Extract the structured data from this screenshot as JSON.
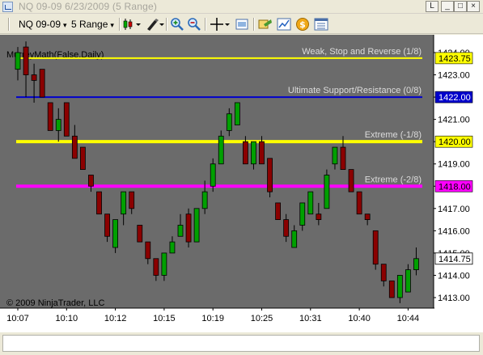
{
  "window": {
    "title": "NQ 09-09  6/23/2009 (5 Range)",
    "buttons": {
      "link": "L",
      "minimize": "_",
      "maximize": "□",
      "close": "×"
    }
  },
  "toolbar": {
    "instrument": "NQ 09-09",
    "interval": "5 Range",
    "icons": [
      "chart-style-icon",
      "draw-tools-icon",
      "zoom-in-icon",
      "zoom-out-icon",
      "crosshair-icon",
      "properties-icon",
      "indicators-icon",
      "strategies-icon",
      "orders-icon",
      "data-box-icon"
    ]
  },
  "chart": {
    "indicator_label": "MurreyMath(False,Daily)",
    "copyright": "© 2009 NinjaTrader, LLC",
    "colors": {
      "background": "#6b6b6b",
      "up": "#00a000",
      "down": "#8b0000",
      "wick": "#000000",
      "axis_bg": "#ffffff"
    }
  },
  "chart_data": {
    "type": "candlestick",
    "y_range": [
      1412.5,
      1424.9
    ],
    "y_ticks": [
      "1424.00",
      "1423.00",
      "1422.00",
      "1421.00",
      "1420.00",
      "1419.00",
      "1418.00",
      "1417.00",
      "1416.00",
      "1415.00",
      "1414.00",
      "1413.00"
    ],
    "x_ticks": [
      {
        "index": 0,
        "label": "10:07"
      },
      {
        "index": 6,
        "label": "10:10"
      },
      {
        "index": 12,
        "label": "10:12"
      },
      {
        "index": 18,
        "label": "10:15"
      },
      {
        "index": 24,
        "label": "10:19"
      },
      {
        "index": 30,
        "label": "10:25"
      },
      {
        "index": 36,
        "label": "10:31"
      },
      {
        "index": 42,
        "label": "10:40"
      },
      {
        "index": 48,
        "label": "10:44"
      }
    ],
    "levels": [
      {
        "name": "Weak, Stop and Reverse (1/8)",
        "value": 1423.75,
        "label": "1423.75",
        "color": "#ffff00",
        "label_bg": "#ffff00",
        "label_fg": "#000000",
        "line_width": 2
      },
      {
        "name": "Ultimate Support/Resistance (0/8)",
        "value": 1422.0,
        "label": "1422.00",
        "color": "#0000cc",
        "label_bg": "#0000cc",
        "label_fg": "#ffffff",
        "line_width": 2
      },
      {
        "name": "Extreme (-1/8)",
        "value": 1420.0,
        "label": "1420.00",
        "color": "#ffff00",
        "label_bg": "#ffff00",
        "label_fg": "#000000",
        "line_width": 4
      },
      {
        "name": "Extreme (-2/8)",
        "value": 1418.0,
        "label": "1418.00",
        "color": "#ff00ff",
        "label_bg": "#ff00ff",
        "label_fg": "#000000",
        "line_width": 4
      }
    ],
    "last_price": {
      "value": 1414.75,
      "label": "1414.75"
    },
    "candles": [
      {
        "o": 1423.25,
        "h": 1424.25,
        "l": 1422.75,
        "c": 1424.0
      },
      {
        "o": 1424.25,
        "h": 1424.5,
        "l": 1422.0,
        "c": 1423.0
      },
      {
        "o": 1423.0,
        "h": 1423.5,
        "l": 1421.75,
        "c": 1422.75
      },
      {
        "o": 1423.25,
        "h": 1423.25,
        "l": 1422.0,
        "c": 1422.0
      },
      {
        "o": 1421.75,
        "h": 1421.75,
        "l": 1420.5,
        "c": 1420.5
      },
      {
        "o": 1420.5,
        "h": 1421.5,
        "l": 1420.0,
        "c": 1421.0
      },
      {
        "o": 1421.75,
        "h": 1421.75,
        "l": 1420.25,
        "c": 1420.25
      },
      {
        "o": 1420.25,
        "h": 1420.75,
        "l": 1419.25,
        "c": 1419.25
      },
      {
        "o": 1419.75,
        "h": 1419.75,
        "l": 1418.75,
        "c": 1418.75
      },
      {
        "o": 1418.5,
        "h": 1418.5,
        "l": 1417.75,
        "c": 1418.0
      },
      {
        "o": 1417.75,
        "h": 1417.75,
        "l": 1416.75,
        "c": 1416.75
      },
      {
        "o": 1416.75,
        "h": 1416.75,
        "l": 1415.5,
        "c": 1415.75
      },
      {
        "o": 1415.25,
        "h": 1416.5,
        "l": 1415.0,
        "c": 1416.5
      },
      {
        "o": 1416.75,
        "h": 1417.75,
        "l": 1416.25,
        "c": 1417.75
      },
      {
        "o": 1417.75,
        "h": 1417.75,
        "l": 1416.75,
        "c": 1417.0
      },
      {
        "o": 1416.25,
        "h": 1416.25,
        "l": 1415.5,
        "c": 1415.5
      },
      {
        "o": 1415.5,
        "h": 1415.5,
        "l": 1414.5,
        "c": 1414.75
      },
      {
        "o": 1414.75,
        "h": 1414.75,
        "l": 1413.75,
        "c": 1414.0
      },
      {
        "o": 1414.0,
        "h": 1415.0,
        "l": 1413.75,
        "c": 1415.0
      },
      {
        "o": 1415.0,
        "h": 1415.75,
        "l": 1415.0,
        "c": 1415.5
      },
      {
        "o": 1415.75,
        "h": 1416.75,
        "l": 1415.75,
        "c": 1416.25
      },
      {
        "o": 1416.75,
        "h": 1417.0,
        "l": 1415.25,
        "c": 1415.5
      },
      {
        "o": 1415.5,
        "h": 1417.0,
        "l": 1415.5,
        "c": 1417.0
      },
      {
        "o": 1417.0,
        "h": 1418.25,
        "l": 1416.75,
        "c": 1417.75
      },
      {
        "o": 1418.0,
        "h": 1419.25,
        "l": 1417.75,
        "c": 1419.0
      },
      {
        "o": 1419.0,
        "h": 1420.5,
        "l": 1419.0,
        "c": 1420.25
      },
      {
        "o": 1420.5,
        "h": 1421.5,
        "l": 1420.25,
        "c": 1421.25
      },
      {
        "o": 1420.75,
        "h": 1421.75,
        "l": 1420.75,
        "c": 1421.75
      },
      {
        "o": 1420.0,
        "h": 1420.25,
        "l": 1419.0,
        "c": 1419.0
      },
      {
        "o": 1419.0,
        "h": 1420.0,
        "l": 1418.75,
        "c": 1420.0
      },
      {
        "o": 1420.0,
        "h": 1420.25,
        "l": 1419.0,
        "c": 1419.0
      },
      {
        "o": 1419.25,
        "h": 1419.25,
        "l": 1417.5,
        "c": 1417.75
      },
      {
        "o": 1417.25,
        "h": 1417.25,
        "l": 1416.5,
        "c": 1416.5
      },
      {
        "o": 1416.5,
        "h": 1416.75,
        "l": 1415.5,
        "c": 1415.75
      },
      {
        "o": 1415.25,
        "h": 1416.25,
        "l": 1415.25,
        "c": 1416.0
      },
      {
        "o": 1416.25,
        "h": 1417.25,
        "l": 1416.0,
        "c": 1417.25
      },
      {
        "o": 1416.75,
        "h": 1417.75,
        "l": 1416.75,
        "c": 1417.75
      },
      {
        "o": 1416.75,
        "h": 1417.25,
        "l": 1416.25,
        "c": 1416.5
      },
      {
        "o": 1417.0,
        "h": 1418.75,
        "l": 1417.0,
        "c": 1418.5
      },
      {
        "o": 1419.0,
        "h": 1419.75,
        "l": 1418.75,
        "c": 1419.75
      },
      {
        "o": 1419.75,
        "h": 1420.25,
        "l": 1418.75,
        "c": 1418.75
      },
      {
        "o": 1418.75,
        "h": 1418.75,
        "l": 1417.75,
        "c": 1417.75
      },
      {
        "o": 1417.75,
        "h": 1417.75,
        "l": 1416.75,
        "c": 1416.75
      },
      {
        "o": 1416.75,
        "h": 1416.75,
        "l": 1416.25,
        "c": 1416.5
      },
      {
        "o": 1416.0,
        "h": 1416.0,
        "l": 1414.25,
        "c": 1414.5
      },
      {
        "o": 1414.5,
        "h": 1414.5,
        "l": 1413.5,
        "c": 1413.75
      },
      {
        "o": 1413.75,
        "h": 1413.75,
        "l": 1413.0,
        "c": 1413.0
      },
      {
        "o": 1413.0,
        "h": 1414.0,
        "l": 1412.75,
        "c": 1414.0
      },
      {
        "o": 1413.25,
        "h": 1414.5,
        "l": 1413.25,
        "c": 1414.25
      },
      {
        "o": 1414.25,
        "h": 1415.25,
        "l": 1414.0,
        "c": 1414.75
      }
    ]
  }
}
